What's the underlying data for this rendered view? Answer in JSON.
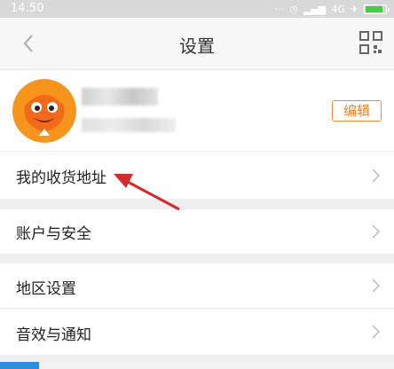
{
  "status_bar": {
    "time": "14:50",
    "network": "4G"
  },
  "nav": {
    "title": "设置"
  },
  "profile": {
    "edit_label": "编辑"
  },
  "menu": [
    {
      "label": "我的收货地址"
    },
    {
      "label": "账户与安全"
    },
    {
      "label": "地区设置"
    },
    {
      "label": "音效与通知"
    }
  ],
  "colors": {
    "accent": "#f0832c",
    "annotation_arrow": "#d42a2a",
    "battery": "#3fcf3f"
  }
}
